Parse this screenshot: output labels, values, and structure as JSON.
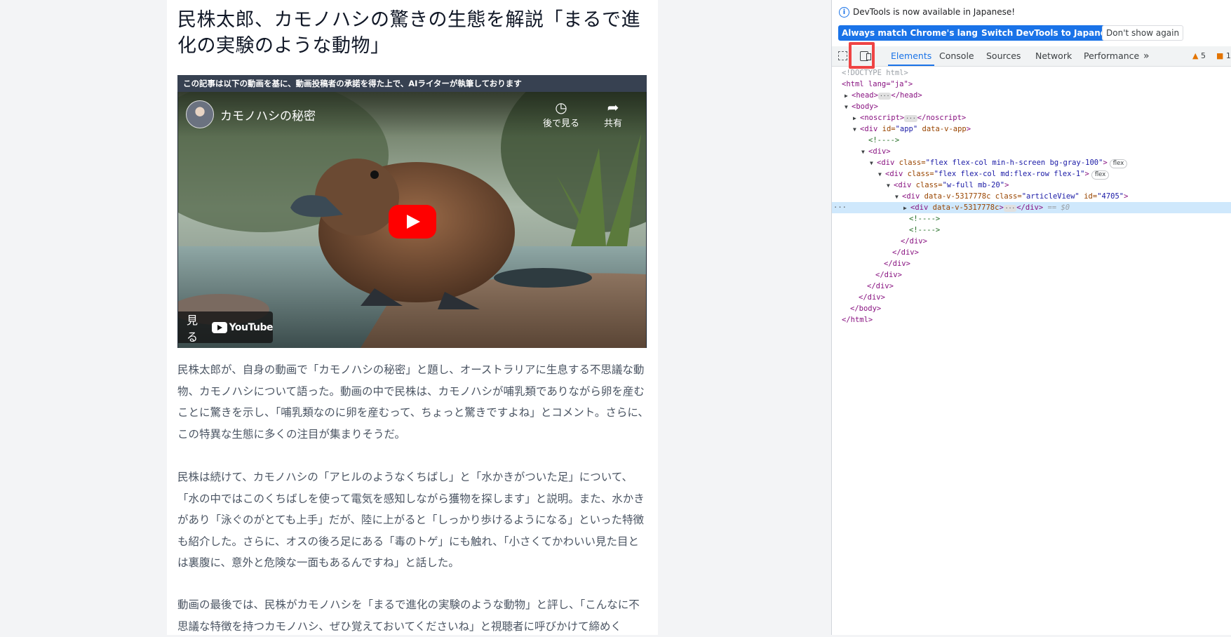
{
  "article": {
    "title": "民株太郎、カモノハシの驚きの生態を解説「まるで進化の実験のような動物」",
    "notice": "この記事は以下の動画を基に、動画投稿者の承諾を得た上で、AIライターが執筆しております",
    "video": {
      "title": "カモノハシの秘密",
      "watch_later": "後で見る",
      "share": "共有",
      "watch_on": "見る",
      "youtube_label": "YouTube"
    },
    "paragraphs": [
      "民株太郎が、自身の動画で「カモノハシの秘密」と題し、オーストラリアに生息する不思議な動物、カモノハシについて語った。動画の中で民株は、カモノハシが哺乳類でありながら卵を産むことに驚きを示し、「哺乳類なのに卵を産むって、ちょっと驚きですよね」とコメント。さらに、この特異な生態に多くの注目が集まりそうだ。",
      "民株は続けて、カモノハシの「アヒルのようなくちばし」と「水かきがついた足」について、「水の中ではこのくちばしを使って電気を感知しながら獲物を探します」と説明。また、水かきがあり「泳ぐのがとても上手」だが、陸に上がると「しっかり歩けるようになる」といった特徴も紹介した。さらに、オスの後ろ足にある「毒のトゲ」にも触れ、「小さくてかわいい見た目とは裏腹に、意外と危険な一面もあるんですね」と話した。",
      "動画の最後では、民株がカモノハシを「まるで進化の実験のような動物」と評し、「こんなに不思議な特徴を持つカモノハシ、ぜひ覚えておいてくださいね」と視聴者に呼びかけて締めく"
    ]
  },
  "devtools": {
    "info_text": "DevTools is now available in Japanese!",
    "buttons": {
      "match": "Always match Chrome's language",
      "switch": "Switch DevTools to Japanese",
      "dont_show": "Don't show again"
    },
    "tabs": [
      "Elements",
      "Console",
      "Sources",
      "Network",
      "Performance"
    ],
    "more_tabs": "»",
    "warnings_count": "5",
    "issues_count": "1",
    "active_tab": "Elements",
    "dom": {
      "doctype": "<!DOCTYPE html>",
      "html_open": "<html lang=\"ja\">",
      "head": "<head>",
      "head_close": "</head>",
      "body": "<body>",
      "noscript": "<noscript>",
      "noscript_close": "</noscript>",
      "div_app_tag": "<div",
      "div_app_attr": " id=",
      "div_app_val": "\"app\"",
      "div_app_attr2": " data-v-app",
      "comment1": "<!---->",
      "div_plain": "<div>",
      "div_flex_open": "<div",
      "div_flex_attr": " class=",
      "div_flex_val": "\"flex flex-col min-h-screen bg-gray-100\"",
      "div_flex2_val": "\"flex flex-col md:flex-row flex-1\"",
      "div_wfull_val": "\"w-full mb-20\"",
      "div_article_attr": " data-v-5317778c class=",
      "div_article_val": "\"articleView\"",
      "div_article_id": " id=",
      "div_article_idval": "\"4705\"",
      "div_selected_attr": " data-v-5317778c",
      "div_close": "</div>",
      "body_close": "</body>",
      "html_close": "</html>",
      "flex_pill": "flex",
      "dollar0": "== $0",
      "gt": ">"
    }
  },
  "colors": {
    "accent": "#1a73e8",
    "highlight": "#ef4444",
    "youtube_red": "#ff0000"
  },
  "icons": [
    "info-icon",
    "inspect-icon",
    "device-toggle-icon",
    "clock-icon",
    "share-icon",
    "play-icon",
    "youtube-logo-icon",
    "warning-icon",
    "issue-icon"
  ]
}
